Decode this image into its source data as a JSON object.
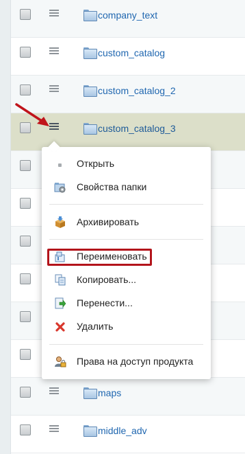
{
  "rows": [
    {
      "name": "company_text"
    },
    {
      "name": "custom_catalog"
    },
    {
      "name": "custom_catalog_2"
    },
    {
      "name": "custom_catalog_3"
    },
    {
      "name": ""
    },
    {
      "name": ""
    },
    {
      "name": ""
    },
    {
      "name": ""
    },
    {
      "name": ""
    },
    {
      "name": ""
    },
    {
      "name": "maps"
    },
    {
      "name": "middle_adv"
    }
  ],
  "context_menu": {
    "items": [
      {
        "label": "Открыть",
        "icon": "dot-icon"
      },
      {
        "label": "Свойства папки",
        "icon": "folder-properties-icon"
      },
      {
        "label": "Архивировать",
        "icon": "archive-box-icon"
      },
      {
        "label": "Переименовать",
        "icon": "rename-icon"
      },
      {
        "label": "Копировать...",
        "icon": "copy-icon"
      },
      {
        "label": "Перенести...",
        "icon": "move-icon"
      },
      {
        "label": "Удалить",
        "icon": "delete-x-icon"
      },
      {
        "label": "Права на доступ продукта",
        "icon": "user-lock-icon"
      }
    ]
  },
  "colors": {
    "link": "#2067b0",
    "selected_row": "#dcdfc9",
    "highlight": "#b3141b",
    "arrow": "#c0141b"
  }
}
